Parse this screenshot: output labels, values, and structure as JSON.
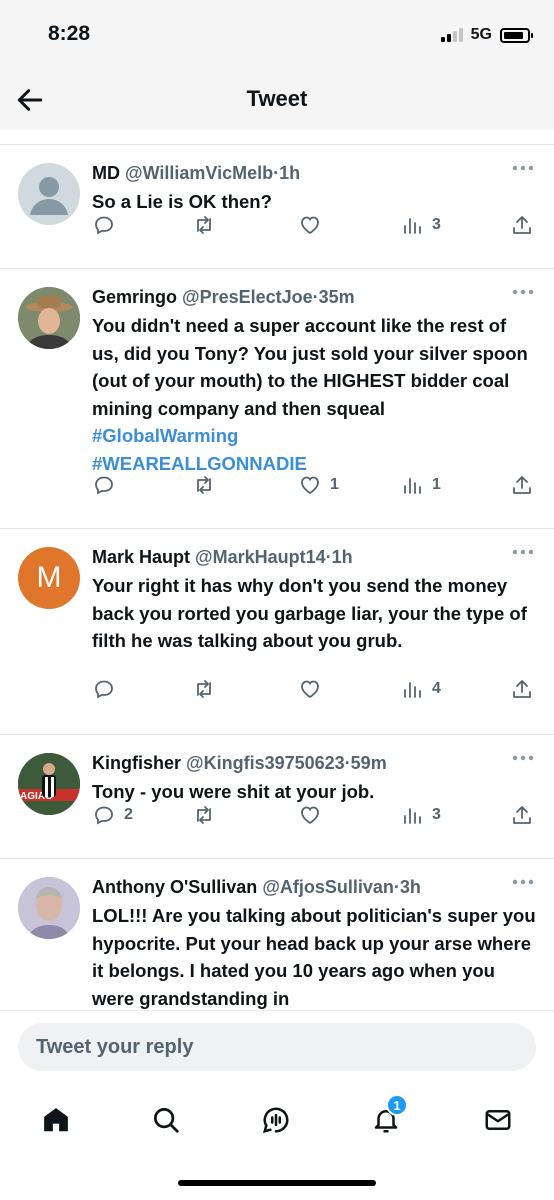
{
  "status_bar": {
    "time": "8:28",
    "network": "5G"
  },
  "header": {
    "title": "Tweet"
  },
  "tweets": [
    {
      "name": "MD",
      "handle": "@WilliamVicMelb",
      "separator": "·",
      "time": "1h",
      "text": "So a Lie is OK then?",
      "replies": "",
      "retweets": "",
      "likes": "",
      "views": "3",
      "avatar": "default"
    },
    {
      "name": "Gemringo",
      "handle": "@PresElectJoe",
      "separator": "·",
      "time": "35m",
      "text": "You didn't need a super account like the rest of us, did you Tony? You just sold your silver spoon (out of your mouth) to the HIGHEST bidder coal mining company and then squeal ",
      "hashtag1": "#GlobalWarming",
      "hashtag2": "#WEAREALLGONNADIE",
      "replies": "",
      "retweets": "",
      "likes": "1",
      "views": "1",
      "avatar": "photo-hat"
    },
    {
      "name": "Mark Haupt",
      "handle": "@MarkHaupt14",
      "separator": "·",
      "time": "1h",
      "text": "Your right it has why don't you send the money back you rorted you garbage liar, your the type of filth he was talking about you grub.",
      "replies": "",
      "retweets": "",
      "likes": "",
      "views": "4",
      "avatar_letter": "M",
      "avatar_color": "#e0762c"
    },
    {
      "name": "Kingfisher",
      "handle": "@Kingfis39750623",
      "separator": "·",
      "time": "59m",
      "text": "Tony - you were shit at your job.",
      "replies": "2",
      "retweets": "",
      "likes": "",
      "views": "3",
      "avatar": "photo-football"
    },
    {
      "name": "Anthony O'Sullivan",
      "handle": "@AfjosSullivan",
      "separator": "·",
      "time": "3h",
      "text": "LOL!!! Are you talking about politician's super you hypocrite. Put your head back up your arse where it belongs. I hated you 10 years ago when you were grandstanding in",
      "avatar": "photo-person"
    }
  ],
  "reply": {
    "placeholder": "Tweet your reply"
  },
  "tabbar": {
    "notifications_badge": "1"
  },
  "colors": {
    "accent": "#1d9bf0",
    "hashtag": "#3b8fd6",
    "muted": "#536471"
  }
}
